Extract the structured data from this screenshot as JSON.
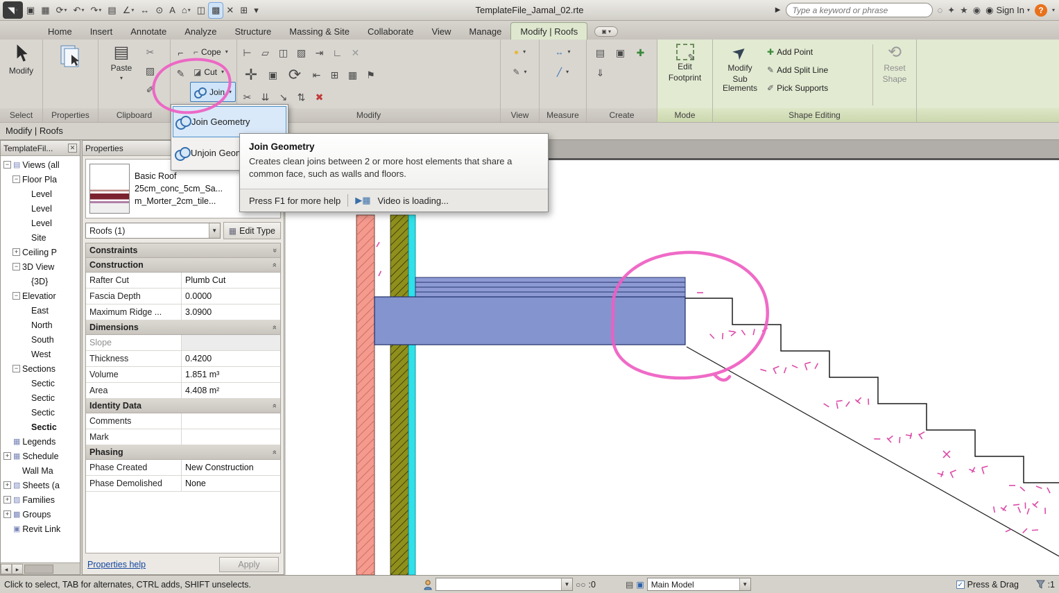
{
  "titlebar": {
    "title": "TemplateFile_Jamal_02.rte",
    "search_placeholder": "Type a keyword or phrase",
    "sign_in": "Sign In",
    "help_glyph": "?",
    "qat": [
      {
        "name": "application-menu-button",
        "glyph": "◥",
        "app": true,
        "drop": true
      },
      {
        "name": "open-icon",
        "glyph": "▣"
      },
      {
        "name": "save-icon",
        "glyph": "▦"
      },
      {
        "name": "sync-icon",
        "glyph": "⟳",
        "drop": true
      },
      {
        "name": "undo-icon",
        "glyph": "↶",
        "drop": true
      },
      {
        "name": "redo-icon",
        "glyph": "↷",
        "drop": true
      },
      {
        "name": "print-icon",
        "glyph": "▤"
      },
      {
        "name": "measure-icon",
        "glyph": "∠",
        "drop": true
      },
      {
        "name": "aligned-dimension-icon",
        "glyph": "↔"
      },
      {
        "name": "tag-icon",
        "glyph": "⊙"
      },
      {
        "name": "text-icon",
        "glyph": "A"
      },
      {
        "name": "default-3d-view-icon",
        "glyph": "⌂",
        "drop": true
      },
      {
        "name": "section-icon",
        "glyph": "◫"
      },
      {
        "name": "switch-windows-icon",
        "glyph": "▩",
        "active": true
      },
      {
        "name": "close-hidden-windows-icon",
        "glyph": "✕"
      },
      {
        "name": "tile-windows-icon",
        "glyph": "⊞"
      },
      {
        "name": "qat-overflow-icon",
        "glyph": "▾"
      }
    ],
    "search_icons": [
      {
        "name": "search-icon",
        "glyph": "◌"
      },
      {
        "name": "communication-center-icon",
        "glyph": "✦"
      },
      {
        "name": "favorites-icon",
        "glyph": "★"
      },
      {
        "name": "sign-in-avatar-icon",
        "glyph": "◉"
      }
    ]
  },
  "tabs": [
    {
      "label": "Home"
    },
    {
      "label": "Insert"
    },
    {
      "label": "Annotate"
    },
    {
      "label": "Analyze"
    },
    {
      "label": "Structure"
    },
    {
      "label": "Massing & Site"
    },
    {
      "label": "Collaborate"
    },
    {
      "label": "View"
    },
    {
      "label": "Manage"
    },
    {
      "label": "Modify | Roofs",
      "active": true
    }
  ],
  "ribbon": {
    "select_label": "Select",
    "modify_button": "Modify",
    "properties_label": "Properties",
    "clipboard_label": "Clipboard",
    "paste": "Paste",
    "clipboard_minis": [
      {
        "g": "✂",
        "name": "cut-to-clipboard-icon",
        "c": "#777"
      },
      {
        "g": "▨",
        "name": "copy-to-clipboard-icon"
      },
      {
        "g": "✐",
        "name": "match-type-properties-icon"
      }
    ],
    "geometry_side": [
      {
        "g": "⌐",
        "name": "wall-joins-icon"
      },
      {
        "g": "✎",
        "name": "paint-icon"
      }
    ],
    "geometry_buttons": [
      {
        "label": "Cope",
        "g": "⌐",
        "name": "cope-button"
      },
      {
        "label": "Cut",
        "g": "◪",
        "name": "cut-geometry-button"
      },
      {
        "label": "Join",
        "circles": true,
        "selected": true,
        "name": "join-button"
      }
    ],
    "modify_panel": "Modify",
    "modify_icons": [
      [
        {
          "g": "⊢",
          "n": "align-icon"
        },
        {
          "g": "▱",
          "n": "offset-icon"
        },
        {
          "g": "◫",
          "n": "mirror-pick-axis-icon"
        },
        {
          "g": "▨",
          "n": "mirror-draw-axis-icon"
        },
        {
          "g": "⇥",
          "n": "extend-icon"
        },
        {
          "g": "∟",
          "n": "trim-icon"
        },
        {
          "g": "✕",
          "n": "cope-disabled-icon",
          "c": "#9a9a9a"
        }
      ],
      [
        {
          "g": "✛",
          "n": "move-icon",
          "big": true
        },
        {
          "g": "▣",
          "n": "copy-icon"
        },
        {
          "g": "⟳",
          "n": "rotate-icon",
          "big": true
        },
        {
          "g": "⇤",
          "n": "split-element-icon"
        },
        {
          "g": "⊞",
          "n": "array-icon"
        },
        {
          "g": "▦",
          "n": "array-path-icon"
        },
        {
          "g": "⚑",
          "n": "pin-icon"
        }
      ],
      [
        {
          "g": "✂",
          "n": "split-icon"
        },
        {
          "g": "⇊",
          "n": "demolish-icon"
        },
        {
          "g": "↘",
          "n": "scale-icon"
        },
        {
          "g": "⇅",
          "n": "unpin-icon"
        },
        {
          "g": "✖",
          "n": "delete-icon",
          "c": "#c23b3b"
        }
      ]
    ],
    "view_panel": "View",
    "view_icons": [
      {
        "g": "●",
        "name": "light-bulb-icon",
        "c": "#e8b93c",
        "drop": true
      },
      {
        "g": "✎",
        "name": "linework-icon",
        "c": "#555",
        "drop": true
      }
    ],
    "measure_panel": "Measure",
    "measure_icons": [
      {
        "g": "↔",
        "name": "aligned-dimension-icon",
        "c": "#2d6db5",
        "drop": true
      },
      {
        "g": "╱",
        "name": "measure-between-icon",
        "c": "#2d6db5",
        "drop": true
      }
    ],
    "create_panel": "Create",
    "create_icons": [
      {
        "g": "▤",
        "name": "legend-component-icon"
      },
      {
        "g": "▣",
        "name": "create-group-icon"
      },
      {
        "g": "✚",
        "name": "create-similar-icon",
        "c": "#3a8a3a"
      },
      {
        "g": "⇓",
        "name": "load-into-project-icon"
      }
    ],
    "mode_panel": "Mode",
    "edit_footprint": [
      "Edit",
      "Footprint"
    ],
    "shape_panel": "Shape Editing",
    "modify_sub": [
      "Modify",
      "Sub Elements"
    ],
    "modify_sub_glyph": "➤",
    "shape_items": [
      {
        "g": "✚",
        "c": "#3a8a3a",
        "label": "Add Point",
        "name": "add-point-button"
      },
      {
        "g": "✎",
        "c": "#555",
        "label": "Add Split Line",
        "name": "add-split-line-button"
      },
      {
        "g": "✐",
        "c": "#555",
        "label": "Pick Supports",
        "name": "pick-supports-button"
      }
    ],
    "reset_shape": [
      "Reset",
      "Shape"
    ],
    "reset_glyph": "⟲"
  },
  "dropdown": {
    "items": [
      {
        "label": "Join Geometry",
        "selected": true
      },
      {
        "label": "Unjoin Geometry"
      }
    ]
  },
  "tooltip": {
    "title": "Join Geometry",
    "body": "Creates clean joins between 2 or more host elements that share a common face, such as walls and floors.",
    "footer": "Press F1 for more help",
    "video": "Video is loading..."
  },
  "context_bar": "Modify | Roofs",
  "browser": {
    "title": "TemplateFil...",
    "items": [
      {
        "t": "Views (all",
        "d": 0,
        "e": "-",
        "g": "▤"
      },
      {
        "t": "Floor Pla",
        "d": 1,
        "e": "-"
      },
      {
        "t": "Level",
        "d": 2
      },
      {
        "t": "Level",
        "d": 2
      },
      {
        "t": "Level",
        "d": 2
      },
      {
        "t": "Site",
        "d": 2
      },
      {
        "t": "Ceiling P",
        "d": 1,
        "e": "+"
      },
      {
        "t": "3D View",
        "d": 1,
        "e": "-"
      },
      {
        "t": "{3D}",
        "d": 2
      },
      {
        "t": "Elevatior",
        "d": 1,
        "e": "-"
      },
      {
        "t": "East",
        "d": 2
      },
      {
        "t": "North",
        "d": 2
      },
      {
        "t": "South",
        "d": 2
      },
      {
        "t": "West",
        "d": 2
      },
      {
        "t": "Sections",
        "d": 1,
        "e": "-"
      },
      {
        "t": "Sectic",
        "d": 2
      },
      {
        "t": "Sectic",
        "d": 2
      },
      {
        "t": "Sectic",
        "d": 2
      },
      {
        "t": "Sectic",
        "d": 2,
        "b": true
      },
      {
        "t": "Legends",
        "d": 0,
        "g": "▦"
      },
      {
        "t": "Schedule",
        "d": 0,
        "e": "+",
        "g": "▦"
      },
      {
        "t": "Wall Ma",
        "d": 1
      },
      {
        "t": "Sheets (a",
        "d": 0,
        "e": "+",
        "g": "▧"
      },
      {
        "t": "Families",
        "d": 0,
        "e": "+",
        "g": "▨"
      },
      {
        "t": "Groups",
        "d": 0,
        "e": "+",
        "g": "▩"
      },
      {
        "t": "Revit Link",
        "d": 0,
        "g": "▣"
      }
    ]
  },
  "properties": {
    "panel_title": "Properties",
    "preview": [
      "Basic Roof",
      "25cm_conc_5cm_Sa...",
      "m_Morter_2cm_tile..."
    ],
    "selector": "Roofs (1)",
    "edit_type": "Edit Type",
    "groups": [
      {
        "name": "Constraints",
        "collapsed": true,
        "rows": []
      },
      {
        "name": "Construction",
        "rows": [
          {
            "n": "Rafter Cut",
            "v": "Plumb Cut"
          },
          {
            "n": "Fascia Depth",
            "v": "0.0000"
          },
          {
            "n": "Maximum Ridge ...",
            "v": "3.0900"
          }
        ]
      },
      {
        "name": "Dimensions",
        "rows": [
          {
            "n": "Slope",
            "v": "",
            "dis": true
          },
          {
            "n": "Thickness",
            "v": "0.4200"
          },
          {
            "n": "Volume",
            "v": "1.851 m³"
          },
          {
            "n": "Area",
            "v": "4.408 m²"
          }
        ]
      },
      {
        "name": "Identity Data",
        "rows": [
          {
            "n": "Comments",
            "v": ""
          },
          {
            "n": "Mark",
            "v": ""
          }
        ]
      },
      {
        "name": "Phasing",
        "rows": [
          {
            "n": "Phase Created",
            "v": "New Construction"
          },
          {
            "n": "Phase Demolished",
            "v": "None"
          }
        ]
      }
    ],
    "help": "Properties help",
    "apply": "Apply"
  },
  "canvas": {
    "colors": {
      "wall_finish": "#f49a8e",
      "wall_core": "#8f901c",
      "wall_membrane": "#2ee1ea",
      "slab": "#8494cf",
      "slab_band": "#8d9ad3",
      "annotation": "#ee5ec2"
    }
  },
  "statusbar": {
    "message": "Click to select, TAB for alternates, CTRL adds, SHIFT unselects.",
    "editable_count": ":0",
    "model": "Main Model",
    "press_drag": "Press & Drag",
    "filter_count": ":1"
  }
}
